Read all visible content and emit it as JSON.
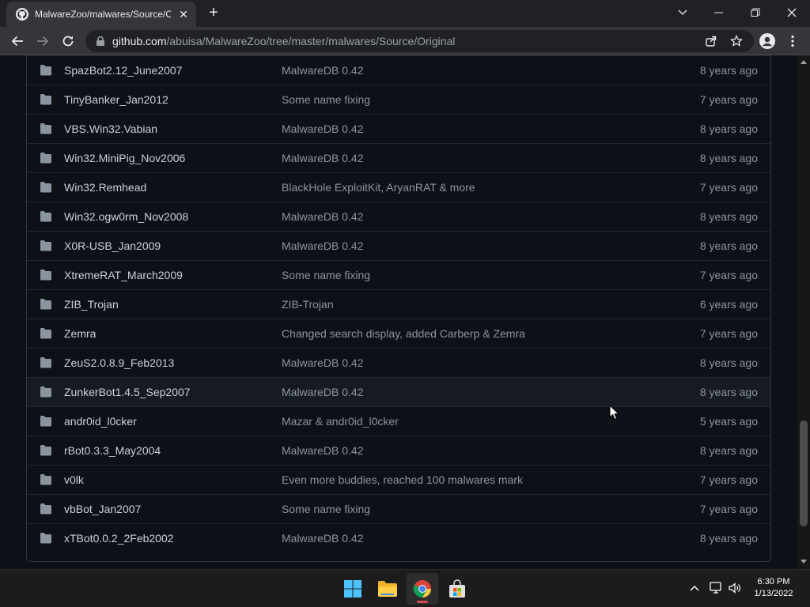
{
  "browser": {
    "tab_title": "MalwareZoo/malwares/Source/Original",
    "url_host": "github.com",
    "url_path": "/abuisa/MalwareZoo/tree/master/malwares/Source/Original"
  },
  "files": [
    {
      "name": "SpazBot2.12_June2007",
      "commit": "MalwareDB 0.42",
      "age": "8 years ago"
    },
    {
      "name": "TinyBanker_Jan2012",
      "commit": "Some name fixing",
      "age": "7 years ago"
    },
    {
      "name": "VBS.Win32.Vabian",
      "commit": "MalwareDB 0.42",
      "age": "8 years ago"
    },
    {
      "name": "Win32.MiniPig_Nov2006",
      "commit": "MalwareDB 0.42",
      "age": "8 years ago"
    },
    {
      "name": "Win32.Remhead",
      "commit": "BlackHole ExploitKit, AryanRAT & more",
      "age": "7 years ago"
    },
    {
      "name": "Win32.ogw0rm_Nov2008",
      "commit": "MalwareDB 0.42",
      "age": "8 years ago"
    },
    {
      "name": "X0R-USB_Jan2009",
      "commit": "MalwareDB 0.42",
      "age": "8 years ago"
    },
    {
      "name": "XtremeRAT_March2009",
      "commit": "Some name fixing",
      "age": "7 years ago"
    },
    {
      "name": "ZIB_Trojan",
      "commit": "ZIB-Trojan",
      "age": "6 years ago"
    },
    {
      "name": "Zemra",
      "commit": "Changed search display, added Carberp & Zemra",
      "age": "7 years ago"
    },
    {
      "name": "ZeuS2.0.8.9_Feb2013",
      "commit": "MalwareDB 0.42",
      "age": "8 years ago"
    },
    {
      "name": "ZunkerBot1.4.5_Sep2007",
      "commit": "MalwareDB 0.42",
      "age": "8 years ago"
    },
    {
      "name": "andr0id_l0cker",
      "commit": "Mazar & andr0id_l0cker",
      "age": "5 years ago"
    },
    {
      "name": "rBot0.3.3_May2004",
      "commit": "MalwareDB 0.42",
      "age": "8 years ago"
    },
    {
      "name": "v0lk",
      "commit": "Even more buddies, reached 100 malwares mark",
      "age": "7 years ago"
    },
    {
      "name": "vbBot_Jan2007",
      "commit": "Some name fixing",
      "age": "7 years ago"
    },
    {
      "name": "xTBot0.0.2_2Feb2002",
      "commit": "MalwareDB 0.42",
      "age": "8 years ago"
    }
  ],
  "taskbar": {
    "time": "6:30 PM",
    "date": "1/13/2022"
  },
  "colors": {
    "folder": "#8b949e",
    "background": "#0d1117",
    "border": "#30363d"
  }
}
